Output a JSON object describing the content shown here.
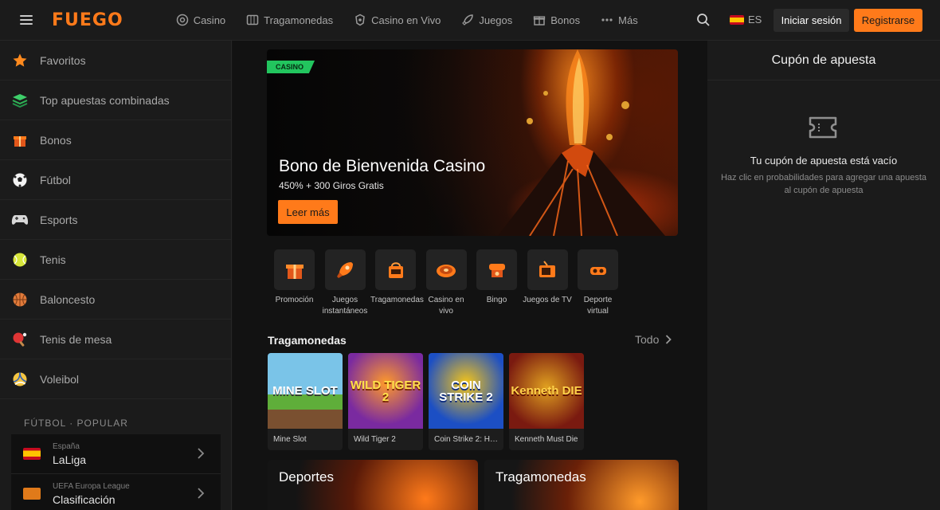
{
  "header": {
    "logo": "FUEGO",
    "nav": [
      {
        "label": "Casino",
        "icon": "chip-icon"
      },
      {
        "label": "Tragamonedas",
        "icon": "slot-icon"
      },
      {
        "label": "Casino en Vivo",
        "icon": "live-casino-icon"
      },
      {
        "label": "Juegos",
        "icon": "rocket-icon"
      },
      {
        "label": "Bonos",
        "icon": "gift-icon"
      },
      {
        "label": "Más",
        "icon": "more-dots-icon"
      }
    ],
    "language": "ES",
    "login_label": "Iniciar sesión",
    "register_label": "Registrarse"
  },
  "sidebar": {
    "items": [
      {
        "label": "Favoritos",
        "icon": "star-icon"
      },
      {
        "label": "Top apuestas combinadas",
        "icon": "stack-icon"
      },
      {
        "label": "Bonos",
        "icon": "bonus-gift-icon"
      },
      {
        "label": "Fútbol",
        "icon": "soccer-ball-icon"
      },
      {
        "label": "Esports",
        "icon": "gamepad-icon"
      },
      {
        "label": "Tenis",
        "icon": "tennis-ball-icon"
      },
      {
        "label": "Baloncesto",
        "icon": "basketball-icon"
      },
      {
        "label": "Tenis de mesa",
        "icon": "ping-pong-icon"
      },
      {
        "label": "Voleibol",
        "icon": "volleyball-icon"
      }
    ],
    "section_title": "FÚTBOL · POPULAR",
    "leagues": [
      {
        "country": "España",
        "name": "LaLiga"
      },
      {
        "country": "UEFA Europa League",
        "name": "Clasificación"
      }
    ]
  },
  "main": {
    "banner": {
      "tag": "CASINO",
      "title": "Bono de Bienvenida Casino",
      "subtitle": "450% + 300 Giros Gratis",
      "button": "Leer más"
    },
    "categories": [
      {
        "label": "Promoción",
        "icon": "promo-gift-icon"
      },
      {
        "label": "Juegos instantáneos",
        "icon": "instant-rocket-icon"
      },
      {
        "label": "Tragamonedas",
        "icon": "slot-machine-icon"
      },
      {
        "label": "Casino en vivo",
        "icon": "roulette-icon"
      },
      {
        "label": "Bingo",
        "icon": "bingo-icon"
      },
      {
        "label": "Juegos de TV",
        "icon": "tv-icon"
      },
      {
        "label": "Deporte virtual",
        "icon": "vr-headset-icon"
      }
    ],
    "slots_section": {
      "title": "Tragamonedas",
      "all_label": "Todo"
    },
    "games": [
      {
        "name": "Mine Slot",
        "thumb_text": "MINE SLOT"
      },
      {
        "name": "Wild Tiger 2",
        "thumb_text": "WILD TIGER 2"
      },
      {
        "name": "Coin Strike 2: Ho...",
        "thumb_text": "COIN STRIKE 2"
      },
      {
        "name": "Kenneth Must Die",
        "thumb_text": "Kenneth DIE"
      }
    ],
    "promos": [
      {
        "title": "Deportes"
      },
      {
        "title": "Tragamonedas"
      }
    ]
  },
  "betslip": {
    "title": "Cupón de apuesta",
    "empty_title": "Tu cupón de apuesta está vacío",
    "empty_hint": "Haz clic en probabilidades para agregar una apuesta al cupón de apuesta"
  }
}
